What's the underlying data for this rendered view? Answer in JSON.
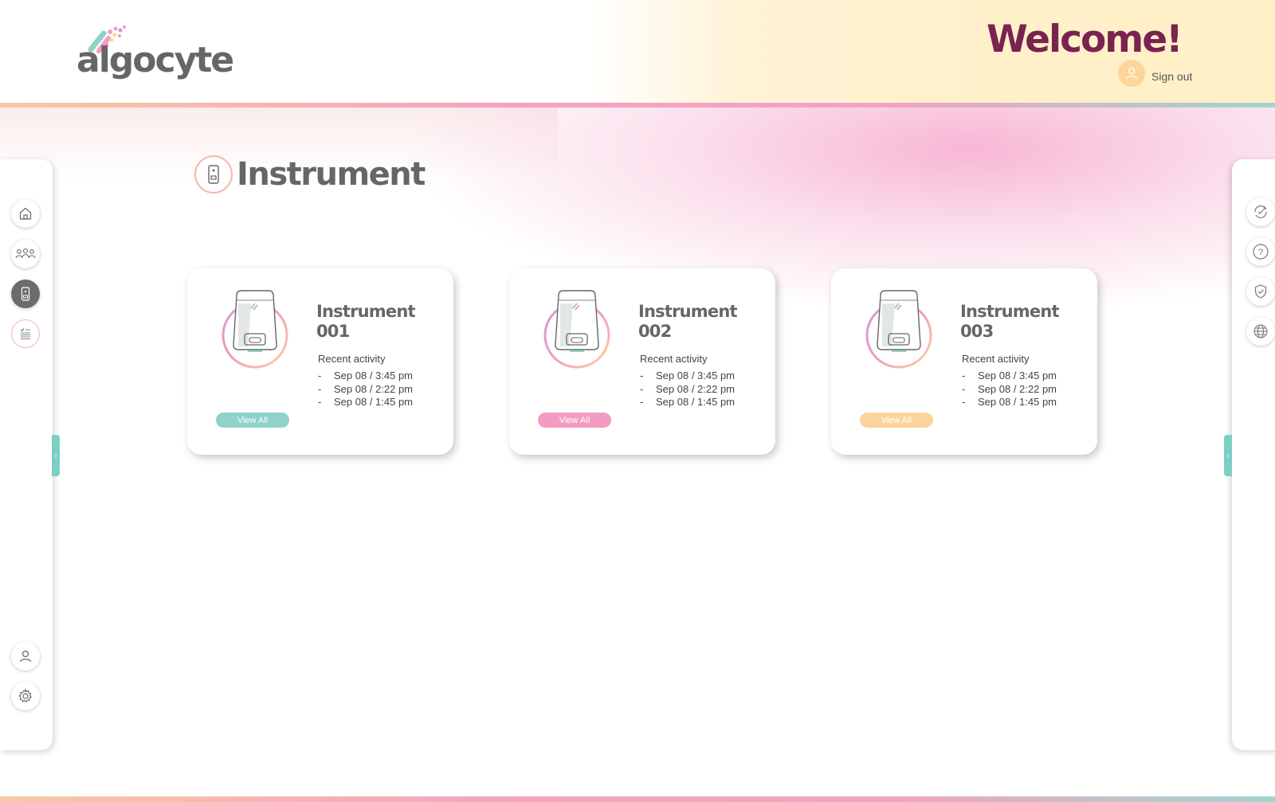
{
  "header": {
    "logo_text": "algocyte",
    "welcome": "Welcome!",
    "sign_out": "Sign out"
  },
  "page": {
    "title": "Instrument"
  },
  "sidebar_left": {
    "items": [
      {
        "icon": "home-icon"
      },
      {
        "icon": "users-icon"
      },
      {
        "icon": "instrument-icon",
        "active": true
      },
      {
        "icon": "checklist-icon"
      },
      {
        "icon": "user-icon"
      },
      {
        "icon": "gear-icon"
      }
    ],
    "toggle": "›"
  },
  "sidebar_right": {
    "items": [
      {
        "icon": "sync-check-icon"
      },
      {
        "icon": "help-icon"
      },
      {
        "icon": "shield-check-icon"
      },
      {
        "icon": "globe-icon"
      }
    ],
    "toggle": "‹"
  },
  "instruments": [
    {
      "name_line1": "Instrument",
      "name_line2": "001",
      "recent_label": "Recent activity",
      "activity": [
        "Sep 08 /  3:45 pm",
        "Sep 08 /  2:22 pm",
        "Sep 08 /  1:45 pm"
      ],
      "button": "View All",
      "accent": "#8ed2c9"
    },
    {
      "name_line1": "Instrument",
      "name_line2": "002",
      "recent_label": "Recent activity",
      "activity": [
        "Sep 08 /  3:45 pm",
        "Sep 08 /  2:22 pm",
        "Sep 08 /  1:45 pm"
      ],
      "button": "View All",
      "accent": "#f39bc3"
    },
    {
      "name_line1": "Instrument",
      "name_line2": "003",
      "recent_label": "Recent activity",
      "activity": [
        "Sep 08 /  3:45 pm",
        "Sep 08 /  2:22 pm",
        "Sep 08 /  1:45 pm"
      ],
      "button": "View All",
      "accent": "#fcd49b"
    }
  ],
  "colors": {
    "welcome": "#7a2350",
    "teal": "#7ccfc5",
    "pink": "#f39bc3",
    "yellow": "#fcd49b"
  }
}
